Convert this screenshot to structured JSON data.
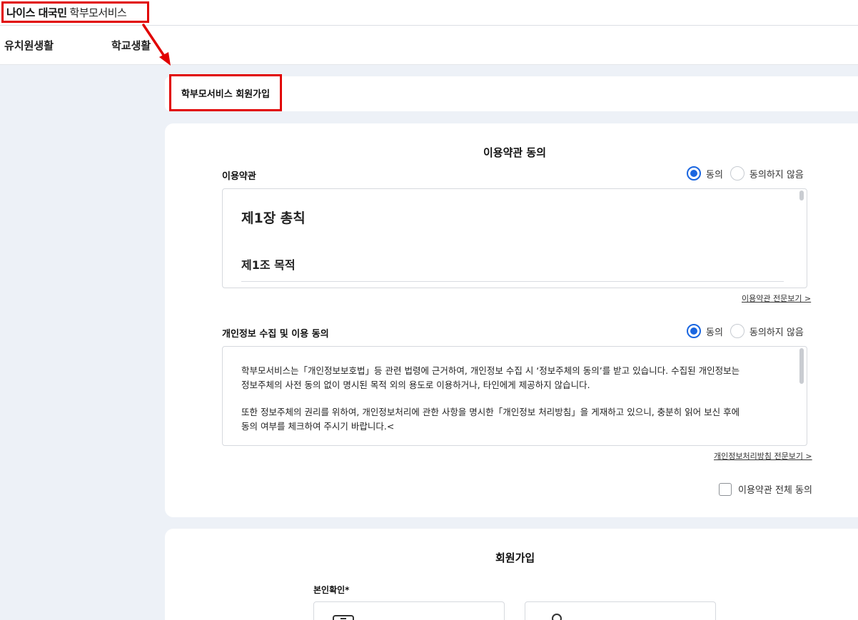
{
  "header": {
    "logo_main": "나이스 대국민",
    "logo_sub": "학부모서비스"
  },
  "nav": {
    "items": [
      {
        "label": "유치원생활"
      },
      {
        "label": "학교생활"
      }
    ]
  },
  "page": {
    "title": "학부모서비스 회원가입"
  },
  "terms_section": {
    "heading": "이용약관 동의",
    "terms": {
      "label": "이용약관",
      "agree_label": "동의",
      "disagree_label": "동의하지 않음",
      "selected": "agree",
      "chapter": "제1장 총칙",
      "article": "제1조 목적",
      "view_all_link": "이용약관 전문보기 >"
    },
    "privacy": {
      "label": "개인정보 수집 및 이용 동의",
      "agree_label": "동의",
      "disagree_label": "동의하지 않음",
      "selected": "agree",
      "line1": "학부모서비스는「개인정보보호법」등 관련 법령에 근거하여, 개인정보 수집 시 ‘정보주체의 동의’를 받고 있습니다. 수집된 개인정보는",
      "line2": "정보주체의 사전 동의 없이 명시된 목적 외의 용도로 이용하거나, 타인에게 제공하지 않습니다.",
      "line3": "또한 정보주체의 권리를 위하여, 개인정보처리에 관한 사항을 명시한「개인정보 처리방침」을 게재하고 있으니, 충분히 읽어 보신 후에",
      "line4": "동의 여부를 체크하여 주시기 바랍니다.<",
      "view_all_link": "개인정보처리방침 전문보기 >"
    },
    "agree_all_label": "이용약관 전체 동의"
  },
  "join_section": {
    "heading": "회원가입",
    "identity_label": "본인확인*"
  },
  "colors": {
    "highlight": "#e10000",
    "accent": "#1a66e0",
    "background": "#edf1f7"
  }
}
